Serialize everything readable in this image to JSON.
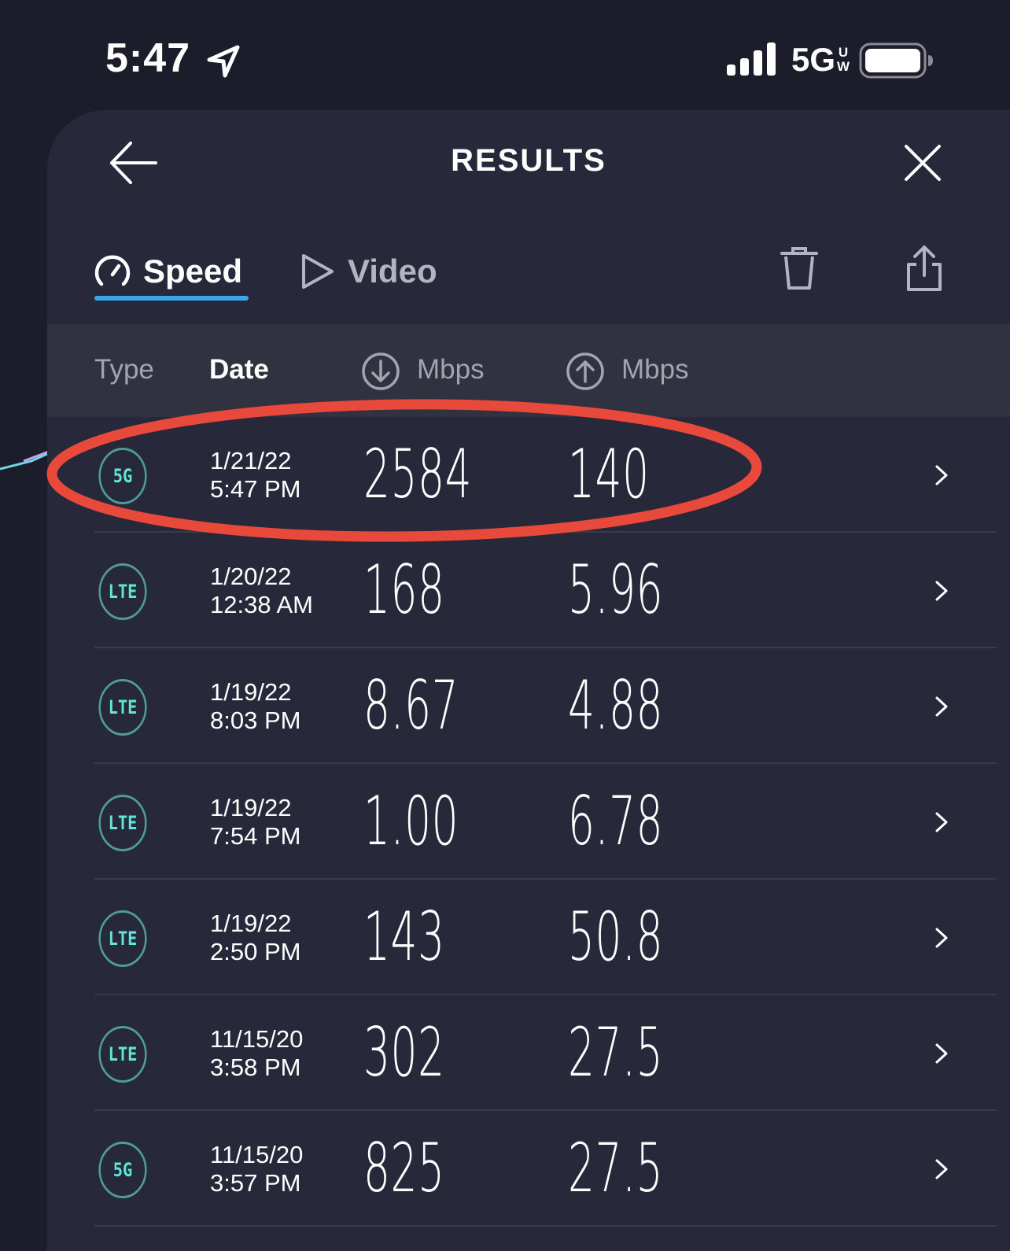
{
  "status_bar": {
    "time": "5:47",
    "network": "5G",
    "network_sup_top": "U",
    "network_sup_bottom": "W"
  },
  "nav": {
    "title": "RESULTS"
  },
  "tabs": [
    {
      "label": "Speed"
    },
    {
      "label": "Video"
    }
  ],
  "table": {
    "headers": {
      "type": "Type",
      "date": "Date",
      "download_unit": "Mbps",
      "upload_unit": "Mbps"
    },
    "rows": [
      {
        "type": "5G",
        "date": "1/21/22",
        "time": "5:47 PM",
        "download": "2584",
        "upload": "140"
      },
      {
        "type": "LTE",
        "date": "1/20/22",
        "time": "12:38 AM",
        "download": "168",
        "upload": "5.96"
      },
      {
        "type": "LTE",
        "date": "1/19/22",
        "time": "8:03 PM",
        "download": "8.67",
        "upload": "4.88"
      },
      {
        "type": "LTE",
        "date": "1/19/22",
        "time": "7:54 PM",
        "download": "1.00",
        "upload": "6.78"
      },
      {
        "type": "LTE",
        "date": "1/19/22",
        "time": "2:50 PM",
        "download": "143",
        "upload": "50.8"
      },
      {
        "type": "LTE",
        "date": "11/15/20",
        "time": "3:58 PM",
        "download": "302",
        "upload": "27.5"
      },
      {
        "type": "5G",
        "date": "11/15/20",
        "time": "3:57 PM",
        "download": "825",
        "upload": "27.5"
      }
    ]
  },
  "colors": {
    "background": "#1c1d2a",
    "sheet": "#272839",
    "accent": "#37a8e8",
    "badge_text": "#5fe6d7",
    "annotation": "#e8493b"
  },
  "icons": [
    "location-arrow-icon",
    "signal-bars-icon",
    "battery-icon",
    "back-arrow-icon",
    "close-icon",
    "speedometer-icon",
    "play-icon",
    "trash-icon",
    "share-icon",
    "download-arrow-icon",
    "upload-arrow-icon",
    "chevron-right-icon"
  ]
}
